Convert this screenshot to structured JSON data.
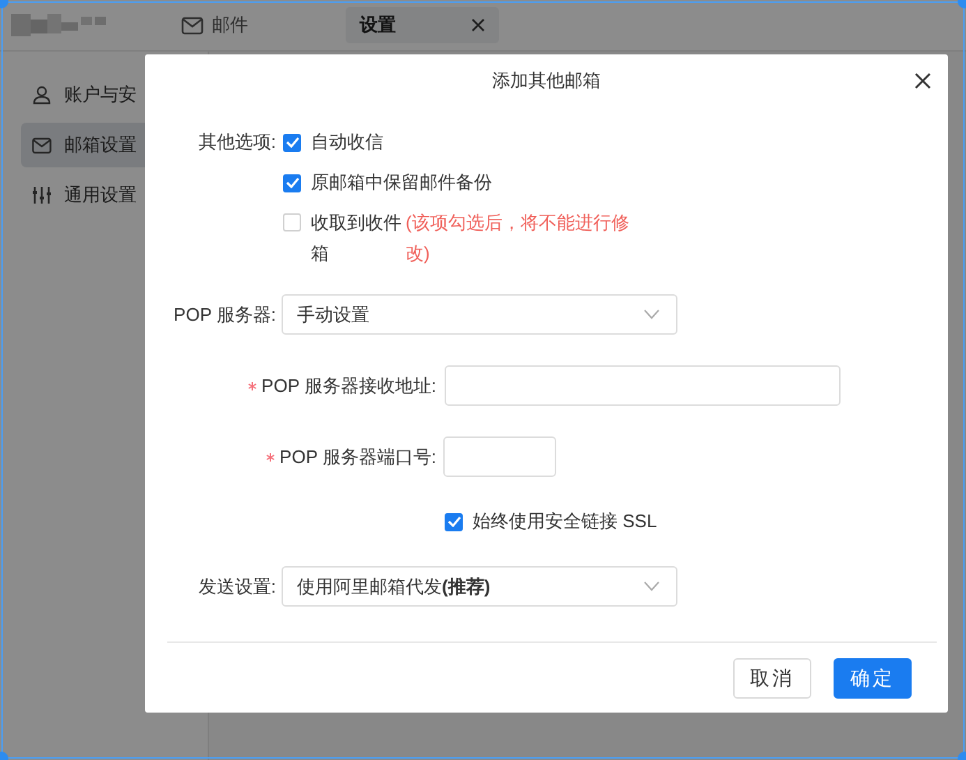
{
  "app": {
    "tabs": [
      {
        "label": "邮件",
        "selected": false,
        "closable": false
      },
      {
        "label": "设置",
        "selected": true,
        "closable": true
      }
    ],
    "sidebar": {
      "items": [
        {
          "label": "账户与安",
          "selected": false
        },
        {
          "label": "邮箱设置",
          "selected": true
        },
        {
          "label": "通用设置",
          "selected": false
        }
      ]
    }
  },
  "dialog": {
    "title": "添加其他邮箱",
    "other_options": {
      "label": "其他选项:",
      "options": [
        {
          "label": "自动收信",
          "checked": true
        },
        {
          "label": "原邮箱中保留邮件备份",
          "checked": true
        },
        {
          "label": "收取到收件箱",
          "checked": false,
          "note": "(该项勾选后，将不能进行修改)"
        }
      ]
    },
    "pop_server": {
      "label": "POP 服务器:",
      "value": "手动设置"
    },
    "pop_address": {
      "label": "POP 服务器接收地址:",
      "required": true
    },
    "pop_port": {
      "label": "POP 服务器端口号:",
      "required": true
    },
    "ssl": {
      "label": "始终使用安全链接 SSL",
      "checked": true
    },
    "send": {
      "label": "发送设置:",
      "value": "使用阿里邮箱代发**(推荐)**"
    },
    "buttons": [
      {
        "label": "取消",
        "kind": "secondary"
      },
      {
        "label": "确定",
        "kind": "primary"
      }
    ]
  }
}
